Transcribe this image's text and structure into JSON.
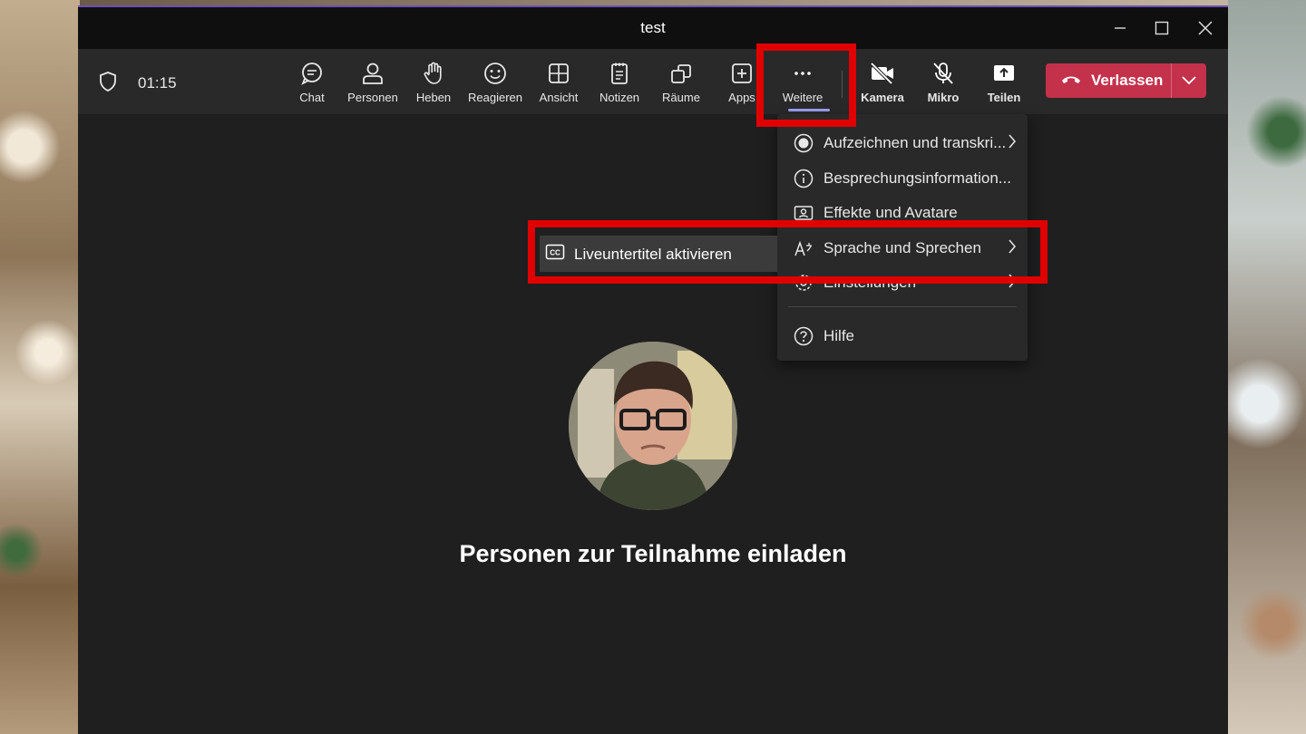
{
  "window": {
    "title": "test"
  },
  "toolbar": {
    "timer": "01:15",
    "items": [
      {
        "label": "Chat",
        "icon": "chat-icon"
      },
      {
        "label": "Personen",
        "icon": "people-icon"
      },
      {
        "label": "Heben",
        "icon": "raise-hand-icon"
      },
      {
        "label": "Reagieren",
        "icon": "smile-icon"
      },
      {
        "label": "Ansicht",
        "icon": "grid-icon"
      },
      {
        "label": "Notizen",
        "icon": "notes-icon"
      },
      {
        "label": "Räume",
        "icon": "rooms-icon"
      },
      {
        "label": "Apps",
        "icon": "add-app-icon"
      },
      {
        "label": "Weitere",
        "icon": "more-icon"
      },
      {
        "label": "Kamera",
        "icon": "camera-off-icon"
      },
      {
        "label": "Mikro",
        "icon": "mic-off-icon"
      },
      {
        "label": "Teilen",
        "icon": "share-icon"
      }
    ],
    "leave_label": "Verlassen"
  },
  "menu": {
    "items": [
      {
        "label": "Aufzeichnen und transkri...",
        "icon": "record-icon",
        "submenu": true
      },
      {
        "label": "Besprechungsinformation...",
        "icon": "info-icon",
        "submenu": false
      },
      {
        "label": "Effekte und Avatare",
        "icon": "effects-icon",
        "submenu": false
      },
      {
        "label": "Sprache und Sprechen",
        "icon": "language-icon",
        "submenu": true
      },
      {
        "label": "Einstellungen",
        "icon": "settings-icon",
        "submenu": true
      },
      {
        "label": "Hilfe",
        "icon": "help-icon",
        "submenu": false
      }
    ]
  },
  "submenu": {
    "label": "Liveuntertitel aktivieren",
    "icon": "cc-icon"
  },
  "stage": {
    "invite_text": "Personen zur Teilnahme einladen"
  },
  "colors": {
    "leave": "#c4314b",
    "highlight": "#e00000",
    "accent": "#9ea2f5"
  }
}
